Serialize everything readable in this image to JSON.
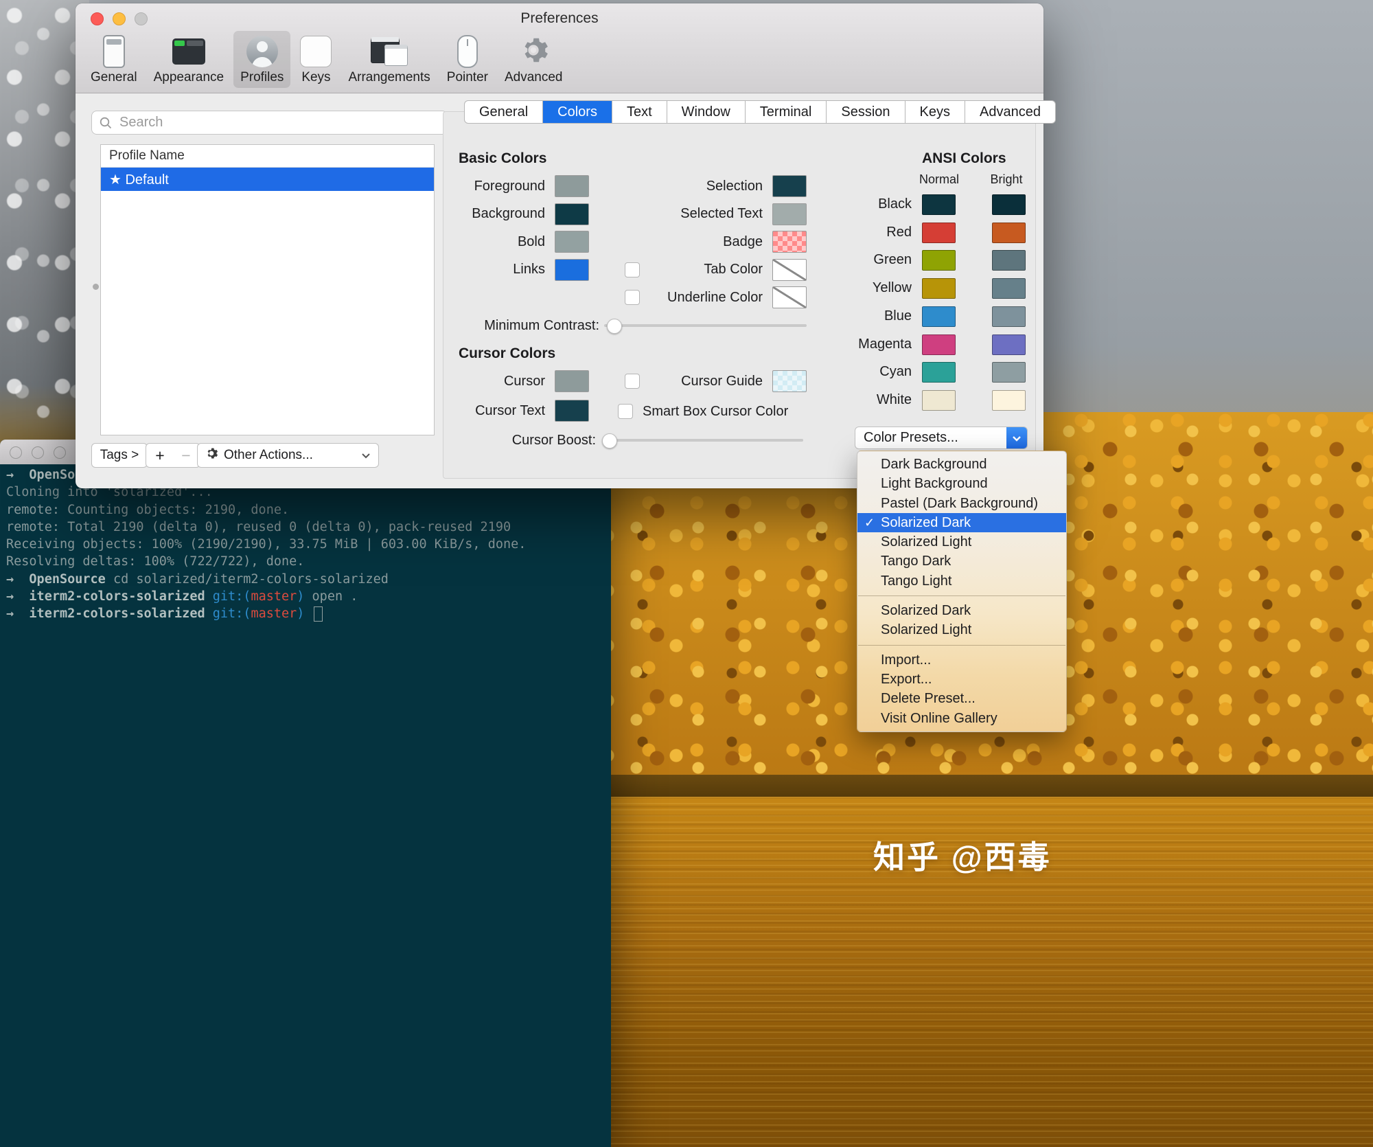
{
  "watermark": {
    "text": "知乎 @西毒"
  },
  "prefs": {
    "title": "Preferences",
    "toolbar": [
      {
        "id": "general",
        "label": "General"
      },
      {
        "id": "appearance",
        "label": "Appearance"
      },
      {
        "id": "profiles",
        "label": "Profiles",
        "selected": true
      },
      {
        "id": "keys",
        "label": "Keys"
      },
      {
        "id": "arrangements",
        "label": "Arrangements"
      },
      {
        "id": "pointer",
        "label": "Pointer"
      },
      {
        "id": "advanced",
        "label": "Advanced"
      }
    ],
    "sidebar": {
      "search_placeholder": "Search",
      "list_header": "Profile Name",
      "profiles": [
        {
          "name": "★ Default",
          "selected": true
        }
      ],
      "tags_label": "Tags >",
      "add_label": "+",
      "remove_label": "−",
      "other_actions_label": "Other Actions..."
    },
    "tabs": [
      {
        "label": "General"
      },
      {
        "label": "Colors",
        "selected": true
      },
      {
        "label": "Text"
      },
      {
        "label": "Window"
      },
      {
        "label": "Terminal"
      },
      {
        "label": "Session"
      },
      {
        "label": "Keys"
      },
      {
        "label": "Advanced"
      }
    ],
    "colors": {
      "basic_title": "Basic Colors",
      "basic_left": [
        {
          "label": "Foreground",
          "color": "#8e9b9b"
        },
        {
          "label": "Background",
          "color": "#0e3a46"
        },
        {
          "label": "Bold",
          "color": "#93a1a1"
        },
        {
          "label": "Links",
          "color": "#1a6ede"
        }
      ],
      "basic_right": [
        {
          "label": "Selection",
          "color": "#16404d"
        },
        {
          "label": "Selected Text",
          "color": "#a2acab"
        },
        {
          "label": "Badge",
          "color": "#ff8a8a",
          "checker": true
        },
        {
          "label": "Tab Color",
          "checkbox": true,
          "empty": true
        },
        {
          "label": "Underline Color",
          "checkbox": true,
          "empty": true
        }
      ],
      "minimum_contrast_label": "Minimum Contrast:",
      "cursor_title": "Cursor Colors",
      "cursor_left": [
        {
          "label": "Cursor",
          "color": "#8e9b9b"
        },
        {
          "label": "Cursor Text",
          "color": "#16404d"
        }
      ],
      "cursor_guide_label": "Cursor Guide",
      "cursor_guide_color": "#d2ecf4",
      "smart_box_label": "Smart Box Cursor Color",
      "cursor_boost_label": "Cursor Boost:",
      "ansi_title": "ANSI Colors",
      "ansi_columns": [
        "Normal",
        "Bright"
      ],
      "ansi_rows": [
        {
          "label": "Black",
          "normal": "#0d3540",
          "bright": "#0a2f3a"
        },
        {
          "label": "Red",
          "normal": "#d53e35",
          "bright": "#c75a20"
        },
        {
          "label": "Green",
          "normal": "#8fa303",
          "bright": "#5e757d"
        },
        {
          "label": "Yellow",
          "normal": "#b79408",
          "bright": "#66808a"
        },
        {
          "label": "Blue",
          "normal": "#2e8ccc",
          "bright": "#7e929c"
        },
        {
          "label": "Magenta",
          "normal": "#cf3f80",
          "bright": "#6d6fc2"
        },
        {
          "label": "Cyan",
          "normal": "#2ba198",
          "bright": "#8e9ea2"
        },
        {
          "label": "White",
          "normal": "#efe8d2",
          "bright": "#fdf4de"
        }
      ],
      "color_presets_label": "Color Presets..."
    }
  },
  "preset_menu": {
    "items": [
      {
        "label": "Dark Background"
      },
      {
        "label": "Light Background"
      },
      {
        "label": "Pastel (Dark Background)"
      },
      {
        "label": "Solarized Dark",
        "checked": true,
        "highlighted": true
      },
      {
        "label": "Solarized Light"
      },
      {
        "label": "Tango Dark"
      },
      {
        "label": "Tango Light"
      },
      {
        "separator": true
      },
      {
        "label": "Solarized Dark"
      },
      {
        "label": "Solarized Light"
      },
      {
        "separator": true
      },
      {
        "label": "Import..."
      },
      {
        "label": "Export..."
      },
      {
        "label": "Delete Preset..."
      },
      {
        "label": "Visit Online Gallery"
      }
    ]
  },
  "terminal": {
    "lines": [
      [
        {
          "t": "→  ",
          "s": "p"
        },
        {
          "t": "OpenSou",
          "s": "b"
        }
      ],
      [
        {
          "t": "Cloning into 'solarized'...",
          "s": "d"
        }
      ],
      [
        {
          "t": "remote: Counting objects: 2190, done.",
          "s": "n"
        }
      ],
      [
        {
          "t": "remote: Total 2190 (delta 0), reused 0 (delta 0), pack-reused 2190",
          "s": "n"
        }
      ],
      [
        {
          "t": "Receiving objects: 100% (2190/2190), 33.75 MiB | 603.00 KiB/s, done.",
          "s": "n"
        }
      ],
      [
        {
          "t": "Resolving deltas: 100% (722/722), done.",
          "s": "n"
        }
      ],
      [
        {
          "t": "→  ",
          "s": "p"
        },
        {
          "t": "OpenSource",
          "s": "b"
        },
        {
          "t": " cd solarized/iterm2-colors-solarized",
          "s": "n"
        }
      ],
      [
        {
          "t": "→  ",
          "s": "p"
        },
        {
          "t": "iterm2-colors-solarized",
          "s": "b"
        },
        {
          "t": " git:(",
          "s": "blu"
        },
        {
          "t": "master",
          "s": "red"
        },
        {
          "t": ")",
          "s": "blu"
        },
        {
          "t": " open .",
          "s": "n"
        }
      ],
      [
        {
          "t": "→  ",
          "s": "p"
        },
        {
          "t": "iterm2-colors-solarized",
          "s": "b"
        },
        {
          "t": " git:(",
          "s": "blu"
        },
        {
          "t": "master",
          "s": "red"
        },
        {
          "t": ")",
          "s": "blu"
        },
        {
          "t": " ",
          "s": "n"
        },
        {
          "t": "",
          "s": "cursor"
        }
      ]
    ]
  }
}
